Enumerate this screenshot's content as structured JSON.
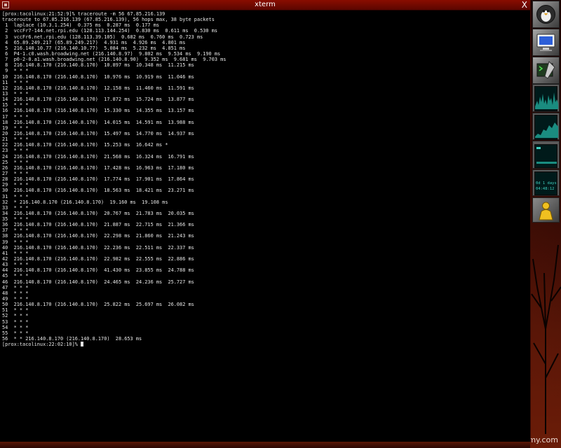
{
  "window": {
    "title": "xterm",
    "close_glyph": "X"
  },
  "terminal": {
    "lines": [
      "[prox:tacolinux:21:52:9]% traceroute -m 56 67.85.216.139",
      "traceroute to 67.85.216.139 (67.85.216.139), 56 hops max, 38 byte packets",
      " 1  laplace (10.3.1.254)  0.375 ms  0.287 ms  0.177 ms",
      " 2  vccFr7-144.net.rpi.edu (128.113.144.254)  0.830 ms  0.611 ms  0.530 ms",
      " 3  vccFr6.net.rpi.edu (128.113.39.105)  0.682 ms  0.760 ms  0.723 ms",
      " 4  65.89.249.217 (65.89.249.217)  4.931 ms  4.926 ms  4.801 ms",
      " 5  216.140.10.77 (216.140.10.77)  5.084 ms  5.232 ms  4.851 ms",
      " 6  P4-1.c0.wash.broadwing.net (216.140.8.97)  9.802 ms  9.534 ms  9.190 ms",
      " 7  p0-2-0.a1.wash.broadwing.net (216.140.8.90)  9.352 ms  9.681 ms  9.703 ms",
      " 8  216.140.8.170 (216.140.8.170)  10.897 ms  10.348 ms  11.215 ms",
      " 9  * * *",
      "10  216.140.8.170 (216.140.8.170)  10.976 ms  10.919 ms  11.046 ms",
      "11  * * *",
      "12  216.140.8.170 (216.140.8.170)  12.158 ms  11.460 ms  11.591 ms",
      "13  * * *",
      "14  216.140.8.170 (216.140.8.170)  17.872 ms  15.724 ms  13.877 ms",
      "15  * * *",
      "16  216.140.8.170 (216.140.8.170)  15.330 ms  14.355 ms  13.157 ms",
      "17  * * *",
      "18  216.140.8.170 (216.140.8.170)  14.015 ms  14.591 ms  13.988 ms",
      "19  * * *",
      "20  216.140.8.170 (216.140.8.170)  15.497 ms  14.770 ms  14.937 ms",
      "21  * * *",
      "22  216.140.8.170 (216.140.8.170)  15.253 ms  16.642 ms *",
      "23  * * *",
      "24  216.140.8.170 (216.140.8.170)  21.568 ms  16.324 ms  16.791 ms",
      "25  * * *",
      "26  216.140.8.170 (216.140.8.170)  17.428 ms  16.963 ms  17.180 ms",
      "27  * * *",
      "28  216.140.8.170 (216.140.8.170)  17.774 ms  17.901 ms  17.864 ms",
      "29  * * *",
      "30  216.140.8.170 (216.140.8.170)  18.563 ms  18.421 ms  23.271 ms",
      "31  * * *",
      "32  * 216.140.8.170 (216.140.8.170)  19.160 ms  19.108 ms",
      "33  * * *",
      "34  216.140.8.170 (216.140.8.170)  20.767 ms  21.783 ms  20.035 ms",
      "35  * * *",
      "36  216.140.8.170 (216.140.8.170)  21.887 ms  22.715 ms  21.366 ms",
      "37  * * *",
      "38  216.140.8.170 (216.140.8.170)  22.298 ms  21.860 ms  21.243 ms",
      "39  * * *",
      "40  216.140.8.170 (216.140.8.170)  22.236 ms  22.511 ms  22.337 ms",
      "41  * * *",
      "42  216.140.8.170 (216.140.8.170)  22.982 ms  22.555 ms  22.886 ms",
      "43  * * *",
      "44  216.140.8.170 (216.140.8.170)  41.430 ms  23.855 ms  24.788 ms",
      "45  * * *",
      "46  216.140.8.170 (216.140.8.170)  24.465 ms  24.236 ms  25.727 ms",
      "47  * * *",
      "48  * * *",
      "49  * * *",
      "50  216.140.8.170 (216.140.8.170)  25.822 ms  25.697 ms  26.082 ms",
      "51  * * *",
      "52  * * *",
      "53  * * *",
      "54  * * *",
      "55  * * *",
      "56  * * 216.140.8.170 (216.140.8.170)  28.653 ms"
    ],
    "prompt": "[prox:tacolinux:22:02:10]% "
  },
  "dock": {
    "icons": [
      "penguin-icon",
      "monitor-icon",
      "terminal-icon",
      "user-icon"
    ],
    "monitor_text": {
      "uptime_line1": "0d 1 days",
      "uptime_line2": "04:48:12"
    }
  },
  "desktop": {
    "brand_text": "my.com"
  },
  "colors": {
    "titlebar": "#8a0d00",
    "terminal_bg": "#000000",
    "terminal_fg": "#e6e6e6",
    "dockapp_text": "#3fd0c0"
  }
}
